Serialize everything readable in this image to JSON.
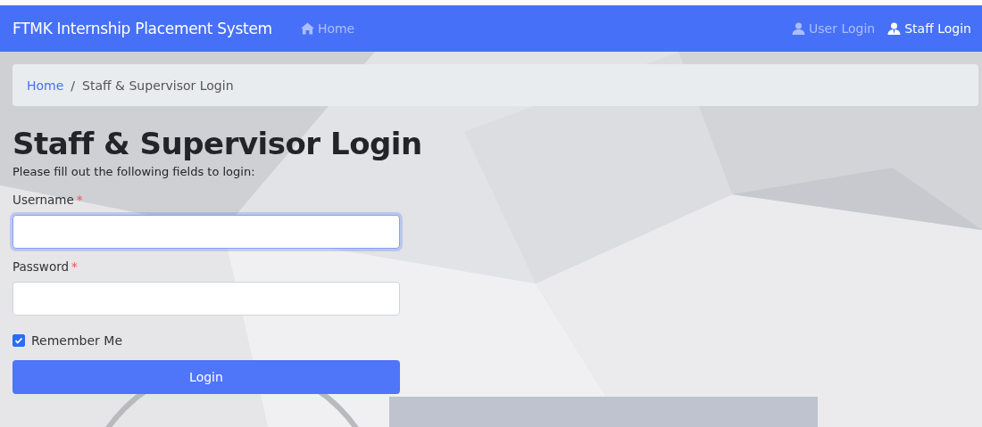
{
  "navbar": {
    "brand": "FTMK Internship Placement System",
    "left_links": [
      {
        "label": "Home",
        "kind": "home",
        "selected": false
      }
    ],
    "right_links": [
      {
        "label": "User Login",
        "kind": "user",
        "selected": false
      },
      {
        "label": "Staff Login",
        "kind": "staff",
        "selected": true
      }
    ]
  },
  "breadcrumb": {
    "link": "Home",
    "separator": "/",
    "current": "Staff & Supervisor Login"
  },
  "heading": "Staff & Supervisor Login",
  "intro": "Please fill out the following fields to login:",
  "fields": [
    {
      "label": "Username",
      "required_mark": "*",
      "focused": true
    },
    {
      "label": "Password",
      "required_mark": "*",
      "focused": false
    }
  ],
  "remember": {
    "label": "Remember Me",
    "checked": true
  },
  "submit": "Login"
}
